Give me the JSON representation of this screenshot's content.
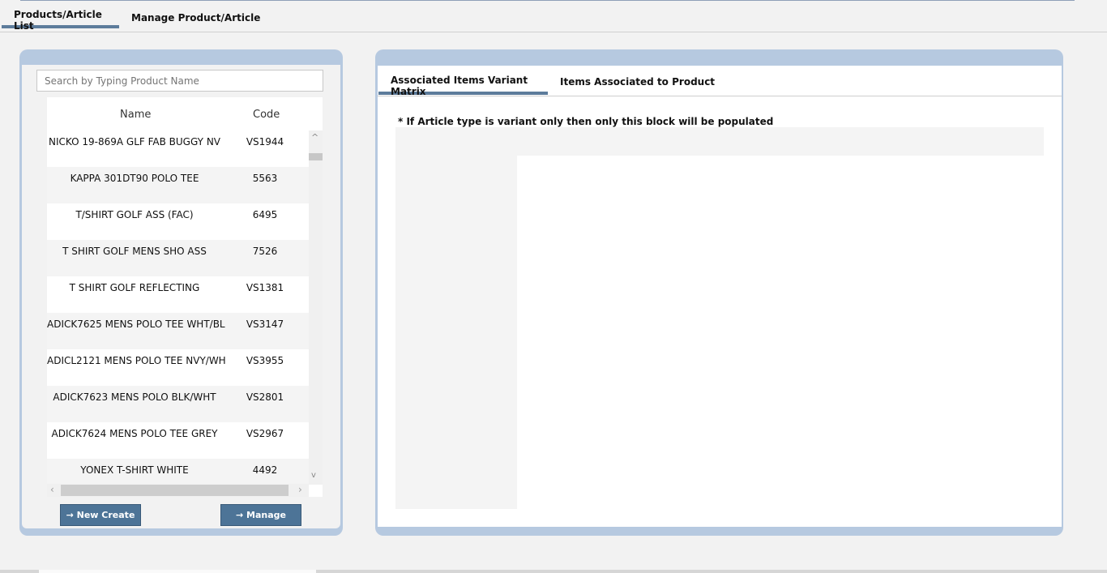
{
  "top_tabs": [
    {
      "label": "Products/Article List",
      "active": true
    },
    {
      "label": "Manage Product/Article",
      "active": false
    }
  ],
  "search": {
    "placeholder": "Search by Typing Product Name"
  },
  "table": {
    "headers": [
      "Name",
      "Code"
    ],
    "rows": [
      {
        "name": "NICKO 19-869A GLF FAB BUGGY NV",
        "code": "VS1944"
      },
      {
        "name": "KAPPA 301DT90 POLO TEE",
        "code": "5563"
      },
      {
        "name": "T/SHIRT GOLF ASS (FAC)",
        "code": "6495"
      },
      {
        "name": "T SHIRT GOLF MENS SHO ASS",
        "code": "7526"
      },
      {
        "name": "T SHIRT GOLF REFLECTING",
        "code": "VS1381"
      },
      {
        "name": "ADICK7625 MENS POLO TEE WHT/BL",
        "code": "VS3147"
      },
      {
        "name": "ADICL2121 MENS POLO TEE NVY/WH",
        "code": "VS3955"
      },
      {
        "name": "ADICK7623 MENS POLO BLK/WHT",
        "code": "VS2801"
      },
      {
        "name": "ADICK7624 MENS POLO TEE GREY",
        "code": "VS2967"
      },
      {
        "name": "YONEX T-SHIRT WHITE",
        "code": "4492"
      }
    ]
  },
  "buttons": {
    "new_create": "→ New Create",
    "manage": "→ Manage"
  },
  "right_tabs": [
    {
      "label": "Associated Items Variant Matrix",
      "active": true
    },
    {
      "label": "Items Associated to Product",
      "active": false
    }
  ],
  "matrix_note": "* If Article type is variant only then only this block will be populated",
  "colors": {
    "panel": "#b6c9e0",
    "button": "#4d7497",
    "accent": "#5d7c9b"
  }
}
